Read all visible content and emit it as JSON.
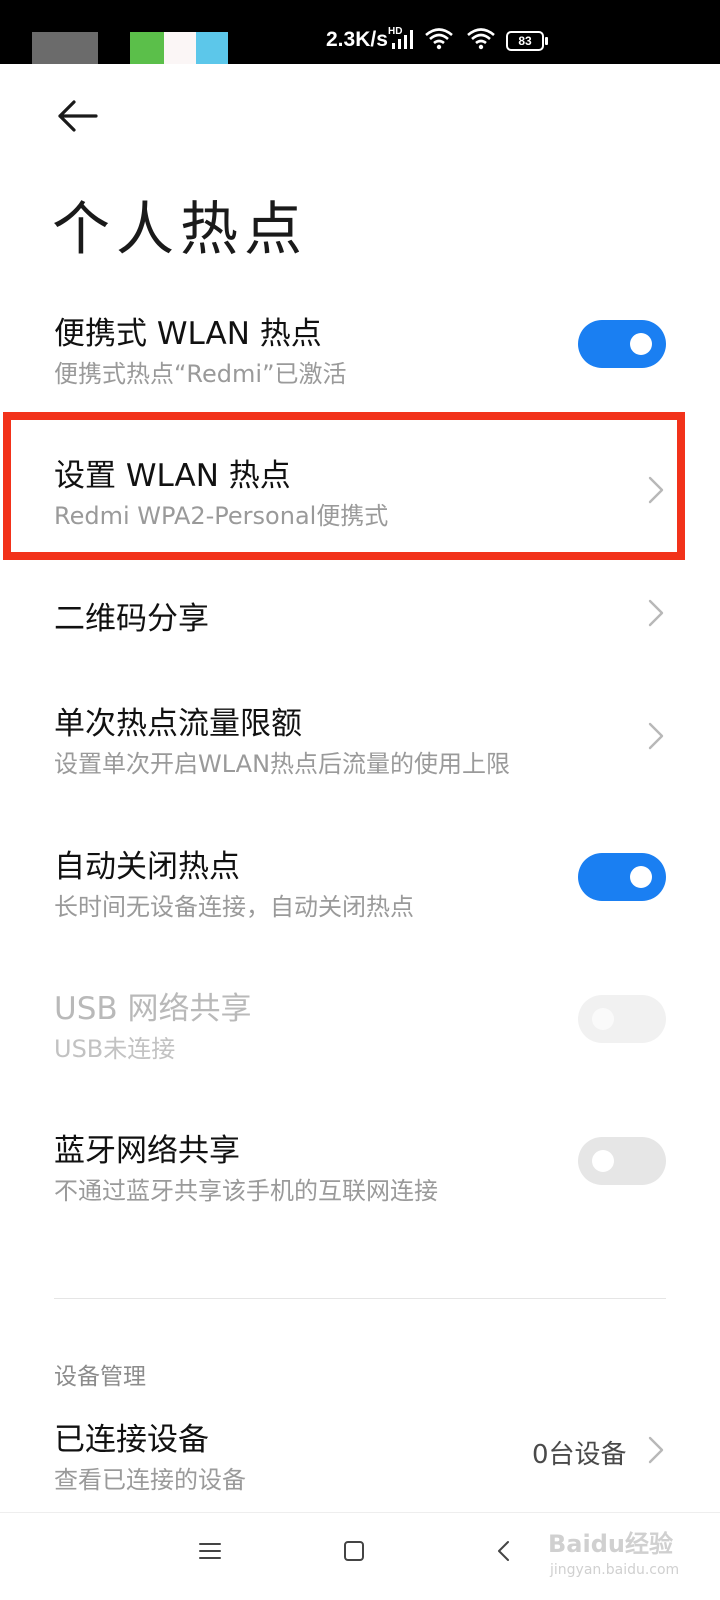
{
  "status_bar": {
    "speed": "2.3K/s",
    "network_badge": "HD",
    "battery": "83"
  },
  "header": {
    "title": "个人热点"
  },
  "rows": [
    {
      "title": "便携式 WLAN 热点",
      "subtitle": "便携式热点“Redmi”已激活",
      "control": "toggle",
      "on": true,
      "enabled": true
    },
    {
      "title": "设置 WLAN 热点",
      "subtitle": "Redmi WPA2-Personal便携式",
      "control": "chevron",
      "highlighted": true
    },
    {
      "title": "二维码分享",
      "control": "chevron"
    },
    {
      "title": "单次热点流量限额",
      "subtitle": "设置单次开启WLAN热点后流量的使用上限",
      "control": "chevron"
    },
    {
      "title": "自动关闭热点",
      "subtitle": "长时间无设备连接，自动关闭热点",
      "control": "toggle",
      "on": true,
      "enabled": true
    },
    {
      "title": "USB 网络共享",
      "subtitle": "USB未连接",
      "control": "toggle",
      "on": false,
      "enabled": false
    },
    {
      "title": "蓝牙网络共享",
      "subtitle": "不通过蓝牙共享该手机的互联网连接",
      "control": "toggle",
      "on": false,
      "enabled": true
    }
  ],
  "device_section": {
    "label": "设备管理",
    "connected": {
      "title": "已连接设备",
      "subtitle": "查看已连接的设备",
      "count": "0台设备"
    }
  },
  "watermark": {
    "logo": "Baidu经验",
    "url": "jingyan.baidu.com"
  },
  "colors": {
    "accent": "#1a7ff2",
    "highlight_frame": "#f2321a",
    "secondary_text": "#9a9a9a"
  },
  "icons": [
    "back-arrow-icon",
    "chevron-right-icon",
    "menu-icon",
    "home-icon",
    "back-nav-icon",
    "wifi-icon",
    "signal-icon",
    "battery-icon"
  ]
}
